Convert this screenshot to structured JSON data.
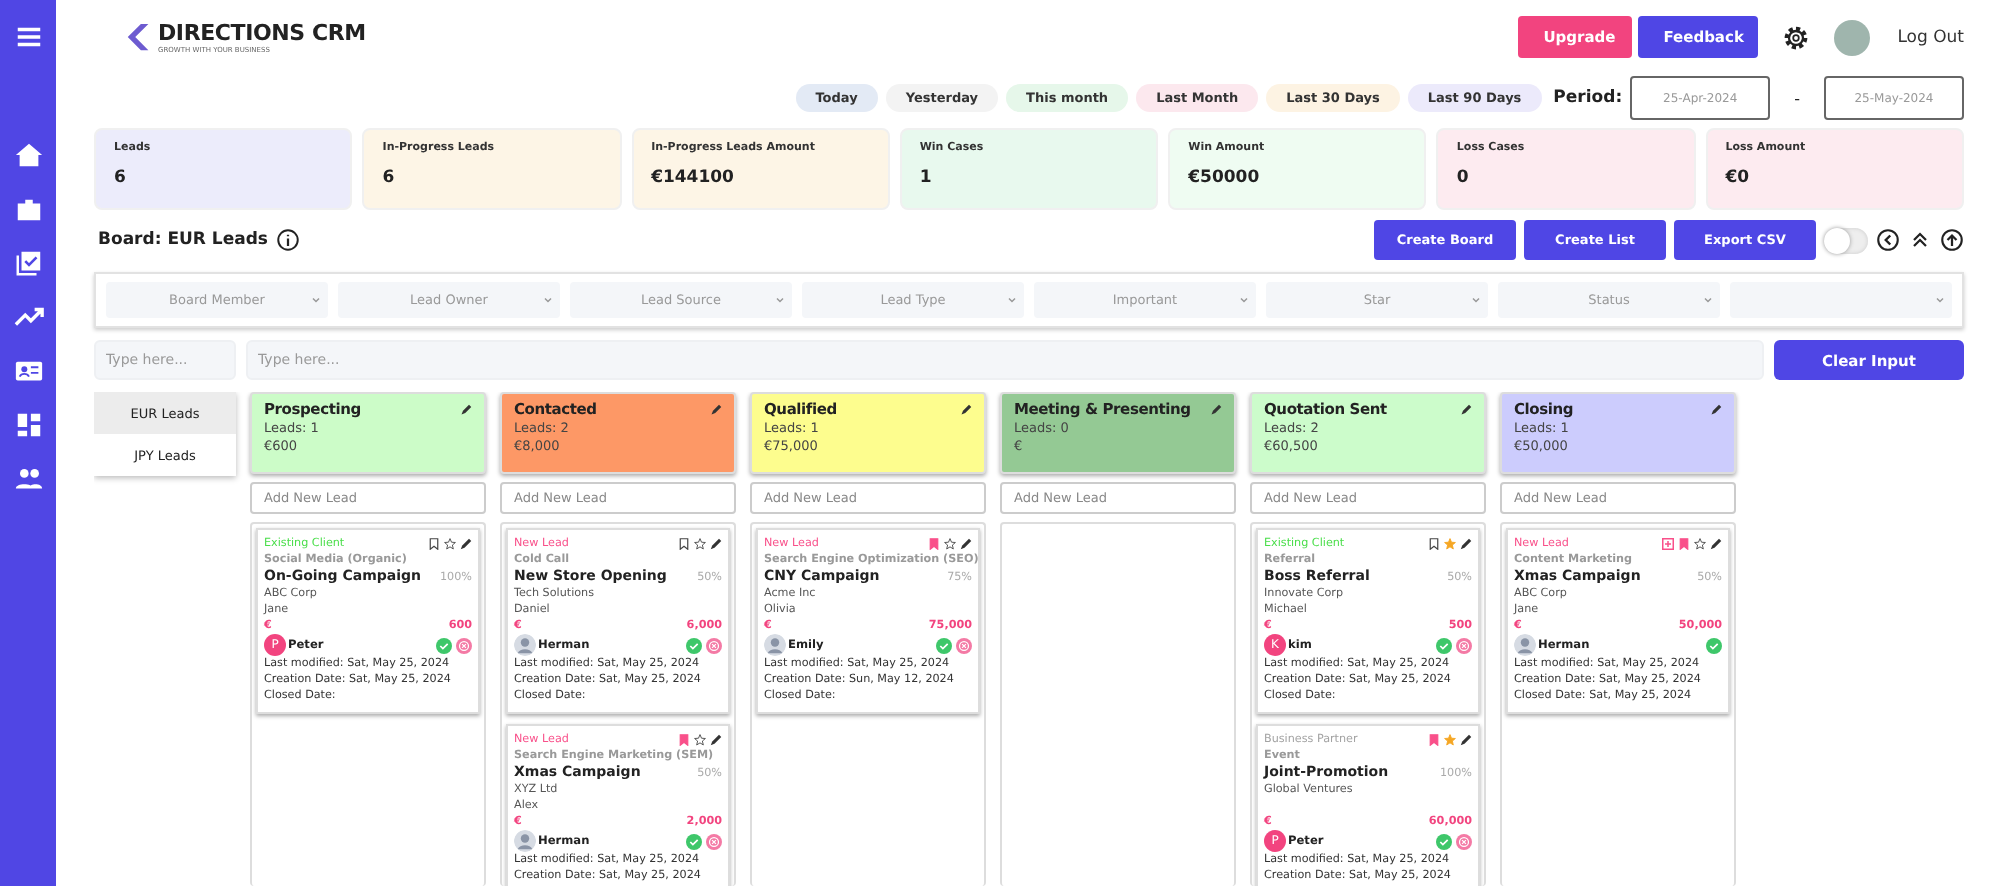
{
  "brand": {
    "name": "DIRECTIONS CRM",
    "tagline": "GROWTH WITH YOUR BUSINESS"
  },
  "header": {
    "upgrade": "Upgrade",
    "feedback": "Feedback",
    "logout": "Log Out"
  },
  "periods": [
    {
      "label": "Today",
      "color": "#e3eaf5"
    },
    {
      "label": "Yesterday",
      "color": "#f3f3f3"
    },
    {
      "label": "This month",
      "color": "#e6f7ea"
    },
    {
      "label": "Last Month",
      "color": "#fce8ee"
    },
    {
      "label": "Last 30 Days",
      "color": "#fdf3e3"
    },
    {
      "label": "Last 90 Days",
      "color": "#eceafb"
    }
  ],
  "period": {
    "label": "Period:",
    "from": "25-Apr-2024",
    "separator": "-",
    "to": "25-May-2024"
  },
  "stats": [
    {
      "label": "Leads",
      "value": "6",
      "color": "#ececfb"
    },
    {
      "label": "In-Progress  Leads",
      "value": "6",
      "color": "#fdf5e6"
    },
    {
      "label": "In-Progress Leads Amount",
      "value": "€144100",
      "color": "#fdf5e6"
    },
    {
      "label": "Win Cases",
      "value": "1",
      "color": "#e8f9ee"
    },
    {
      "label": "Win Amount",
      "value": "€50000",
      "color": "#effcf2"
    },
    {
      "label": "Loss Cases",
      "value": "0",
      "color": "#fdebf0"
    },
    {
      "label": "Loss Amount",
      "value": "€0",
      "color": "#fdebf0"
    }
  ],
  "board": {
    "title": "Board: EUR Leads",
    "actions": [
      "Create Board",
      "Create List",
      "Export CSV"
    ],
    "toggle_on": false
  },
  "filters": [
    {
      "kind": "dropdown",
      "label": "Board Member"
    },
    {
      "kind": "dropdown",
      "label": "Lead Owner"
    },
    {
      "kind": "dropdown",
      "label": "Lead Source"
    },
    {
      "kind": "dropdown",
      "label": "Lead Type"
    },
    {
      "kind": "dropdown",
      "label": "Important"
    },
    {
      "kind": "dropdown",
      "label": "Star"
    },
    {
      "kind": "dropdown",
      "label": "Status"
    },
    {
      "kind": "dropdown"
    }
  ],
  "search": {
    "small_placeholder": "Type here...",
    "placeholder": "Type here...",
    "clear": "Clear Input"
  },
  "boards": [
    {
      "label": "EUR Leads",
      "selected": true
    },
    {
      "label": "JPY Leads",
      "selected": false
    }
  ],
  "columns": [
    {
      "name": "Prospecting",
      "leads": "Leads: 1",
      "amount": "€600",
      "color": "#ccfcc8",
      "add": "Add New Lead",
      "cards": [
        {
          "type": "Existing Client",
          "color": "#4ade4a",
          "source": "Social Media (Organic)",
          "title": "On-Going Campaign",
          "percent": "100%",
          "company": "ABC Corp",
          "contact": "Jane",
          "currency": "€",
          "amount": "600",
          "owner": "Peter",
          "avatar": {
            "kind": "initial",
            "letter": "P"
          },
          "flagged": false,
          "bookmarked": false,
          "starred": false,
          "rejectable": true,
          "modified": "Last modified: Sat, May 25, 2024",
          "created": "Creation Date: Sat, May 25, 2024",
          "closed": "Closed Date:"
        }
      ]
    },
    {
      "name": "Contacted",
      "leads": "Leads: 2",
      "amount": "€8,000",
      "color": "#fd9866",
      "add": "Add New Lead",
      "cards": [
        {
          "type": "New Lead",
          "color": "#f9508a",
          "source": "Cold Call",
          "title": "New Store Opening",
          "percent": "50%",
          "company": "Tech Solutions",
          "contact": "Daniel",
          "currency": "€",
          "amount": "6,000",
          "owner": "Herman",
          "avatar": {
            "kind": "photo"
          },
          "flagged": false,
          "bookmarked": false,
          "starred": false,
          "rejectable": true,
          "modified": "Last modified: Sat, May 25, 2024",
          "created": "Creation Date: Sat, May 25, 2024",
          "closed": "Closed Date:"
        },
        {
          "type": "New Lead",
          "color": "#f9508a",
          "source": "Search Engine Marketing (SEM)",
          "title": "Xmas Campaign",
          "percent": "50%",
          "company": "XYZ Ltd",
          "contact": "Alex",
          "currency": "€",
          "amount": "2,000",
          "owner": "Herman",
          "avatar": {
            "kind": "photo"
          },
          "flagged": false,
          "bookmarked": true,
          "starred": false,
          "rejectable": true,
          "modified": "Last modified: Sat, May 25, 2024",
          "created": "Creation Date: Sat, May 25, 2024"
        }
      ]
    },
    {
      "name": "Qualified",
      "leads": "Leads: 1",
      "amount": "€75,000",
      "color": "#fdfd8e",
      "add": "Add New Lead",
      "cards": [
        {
          "type": "New Lead",
          "color": "#f9508a",
          "source": "Search Engine Optimization (SEO)",
          "title": "CNY Campaign",
          "percent": "75%",
          "company": "Acme Inc",
          "contact": "Olivia",
          "currency": "€",
          "amount": "75,000",
          "owner": "Emily",
          "avatar": {
            "kind": "photo"
          },
          "flagged": false,
          "bookmarked": true,
          "starred": false,
          "rejectable": true,
          "modified": "Last modified: Sat, May 25, 2024",
          "created": "Creation Date: Sun, May 12, 2024",
          "closed": "Closed Date:"
        }
      ]
    },
    {
      "name": "Meeting & Presenting",
      "leads": "Leads: 0",
      "amount": "€",
      "color": "#94c994",
      "add": "Add New Lead"
    },
    {
      "name": "Quotation Sent",
      "leads": "Leads: 2",
      "amount": "€60,500",
      "color": "#ccfccb",
      "add": "Add New Lead",
      "cards": [
        {
          "type": "Existing Client",
          "color": "#4ade4a",
          "source": "Referral",
          "title": "Boss Referral",
          "percent": "50%",
          "company": "Innovate Corp",
          "contact": "Michael",
          "currency": "€",
          "amount": "500",
          "owner": "kim",
          "avatar": {
            "kind": "initial",
            "letter": "K"
          },
          "flagged": false,
          "bookmarked": false,
          "starred": true,
          "rejectable": true,
          "modified": "Last modified: Sat, May 25, 2024",
          "created": "Creation Date: Sat, May 25, 2024",
          "closed": "Closed Date:"
        },
        {
          "type": "Business Partner",
          "color": "#a3a3a3",
          "source": "Event",
          "title": "Joint-Promotion",
          "percent": "100%",
          "company": "Global Ventures",
          "currency": "€",
          "amount": "60,000",
          "owner": "Peter",
          "avatar": {
            "kind": "initial",
            "letter": "P"
          },
          "flagged": false,
          "bookmarked": true,
          "starred": true,
          "rejectable": true,
          "modified": "Last modified: Sat, May 25, 2024",
          "created": "Creation Date: Sat, May 25, 2024"
        }
      ]
    },
    {
      "name": "Closing",
      "leads": "Leads: 1",
      "amount": "€50,000",
      "color": "#ccccfd",
      "add": "Add New Lead",
      "cards": [
        {
          "type": "New Lead",
          "color": "#f9508a",
          "source": "Content Marketing",
          "title": "Xmas Campaign",
          "percent": "50%",
          "company": "ABC Corp",
          "contact": "Jane",
          "currency": "€",
          "amount": "50,000",
          "owner": "Herman",
          "avatar": {
            "kind": "photo"
          },
          "flagged": true,
          "bookmarked": true,
          "starred": false,
          "rejectable": false,
          "modified": "Last modified: Sat, May 25, 2024",
          "created": "Creation Date: Sat, May 25, 2024",
          "closed": "Closed Date: Sat, May 25, 2024"
        }
      ]
    }
  ]
}
